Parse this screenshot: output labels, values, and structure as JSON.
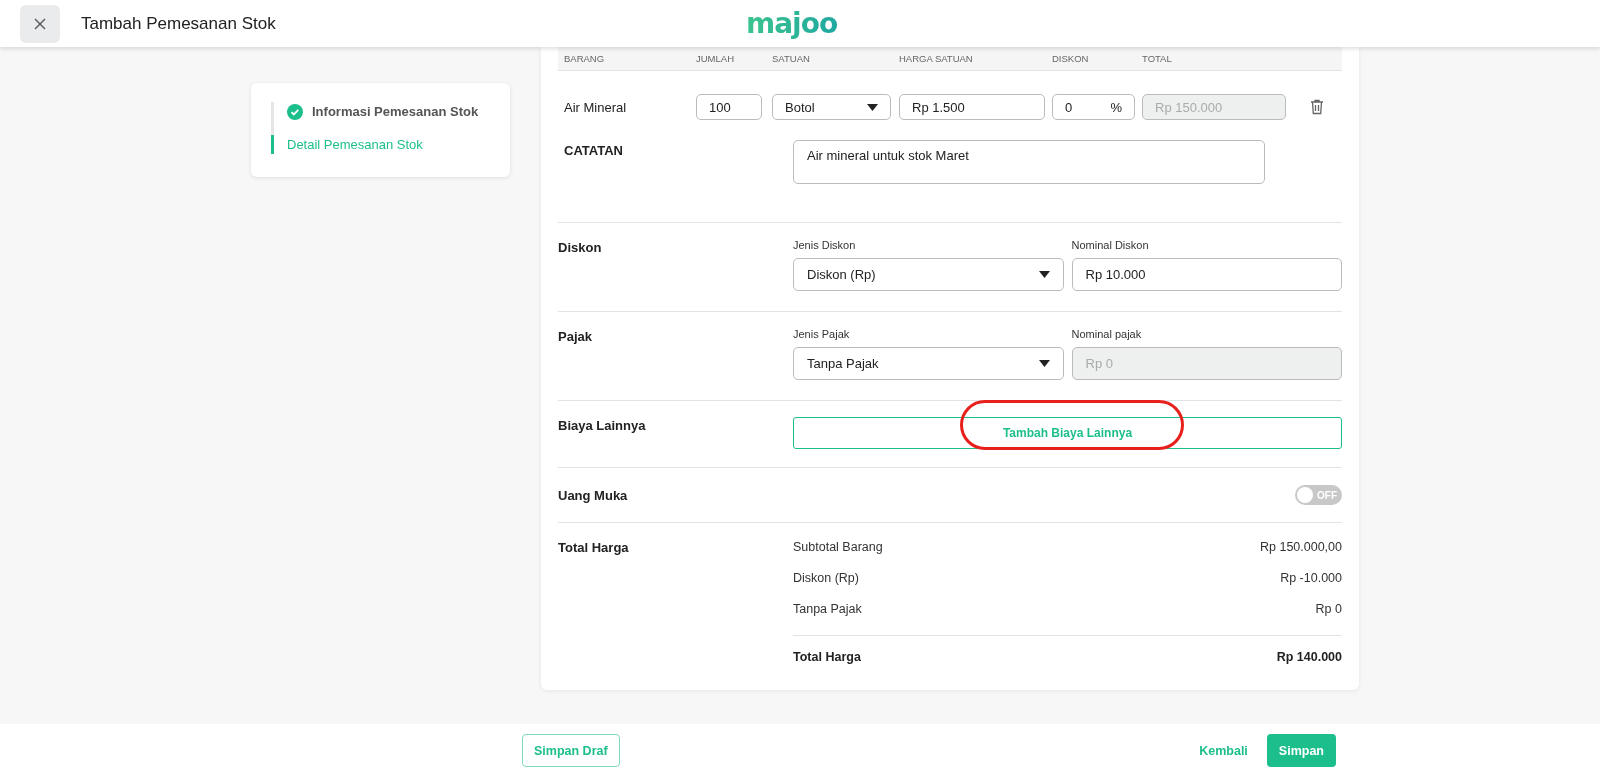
{
  "header": {
    "title": "Tambah Pemesanan Stok",
    "logo": "majoo"
  },
  "steps": [
    {
      "label": "Informasi Pemesanan Stok",
      "completed": true,
      "selected": false
    },
    {
      "label": "Detail Pemesanan Stok",
      "completed": false,
      "selected": true
    }
  ],
  "items_table": {
    "columns": [
      "BARANG",
      "JUMLAH",
      "SATUAN",
      "HARGA SATUAN",
      "DISKON",
      "TOTAL"
    ],
    "rows": [
      {
        "barang": "Air Mineral",
        "jumlah": "100",
        "satuan": "Botol",
        "harga_satuan": "Rp 1.500",
        "diskon": "0",
        "diskon_unit": "%",
        "total": "Rp 150.000",
        "total_disabled": true
      }
    ]
  },
  "note": {
    "label": "CATATAN",
    "value": "Air mineral untuk stok Maret"
  },
  "sections": [
    {
      "kind": "fields",
      "label": "Diskon",
      "fields": [
        {
          "kind": "select",
          "label": "Jenis Diskon",
          "value": "Diskon (Rp)",
          "disabled": false
        },
        {
          "kind": "input",
          "label": "Nominal Diskon",
          "value": "Rp 10.000",
          "disabled": false
        }
      ]
    },
    {
      "kind": "fields",
      "label": "Pajak",
      "fields": [
        {
          "kind": "select",
          "label": "Jenis Pajak",
          "value": "Tanpa Pajak",
          "disabled": false
        },
        {
          "kind": "input",
          "label": "Nominal pajak",
          "value": "Rp 0",
          "disabled": true
        }
      ]
    },
    {
      "kind": "button",
      "label": "Biaya Lainnya",
      "button": "Tambah Biaya Lainnya"
    },
    {
      "kind": "toggle",
      "label": "Uang Muka",
      "on": false,
      "state_text": "OFF"
    }
  ],
  "total": {
    "label": "Total Harga",
    "lines": [
      {
        "label": "Subtotal Barang",
        "value": "Rp 150.000,00"
      },
      {
        "label": "Diskon (Rp)",
        "value": "Rp -10.000"
      },
      {
        "label": "Tanpa Pajak",
        "value": "Rp 0"
      }
    ],
    "grand": {
      "label": "Total Harga",
      "value": "Rp 140.000"
    }
  },
  "footer": {
    "draft": "Simpan Draf",
    "back": "Kembali",
    "save": "Simpan"
  }
}
